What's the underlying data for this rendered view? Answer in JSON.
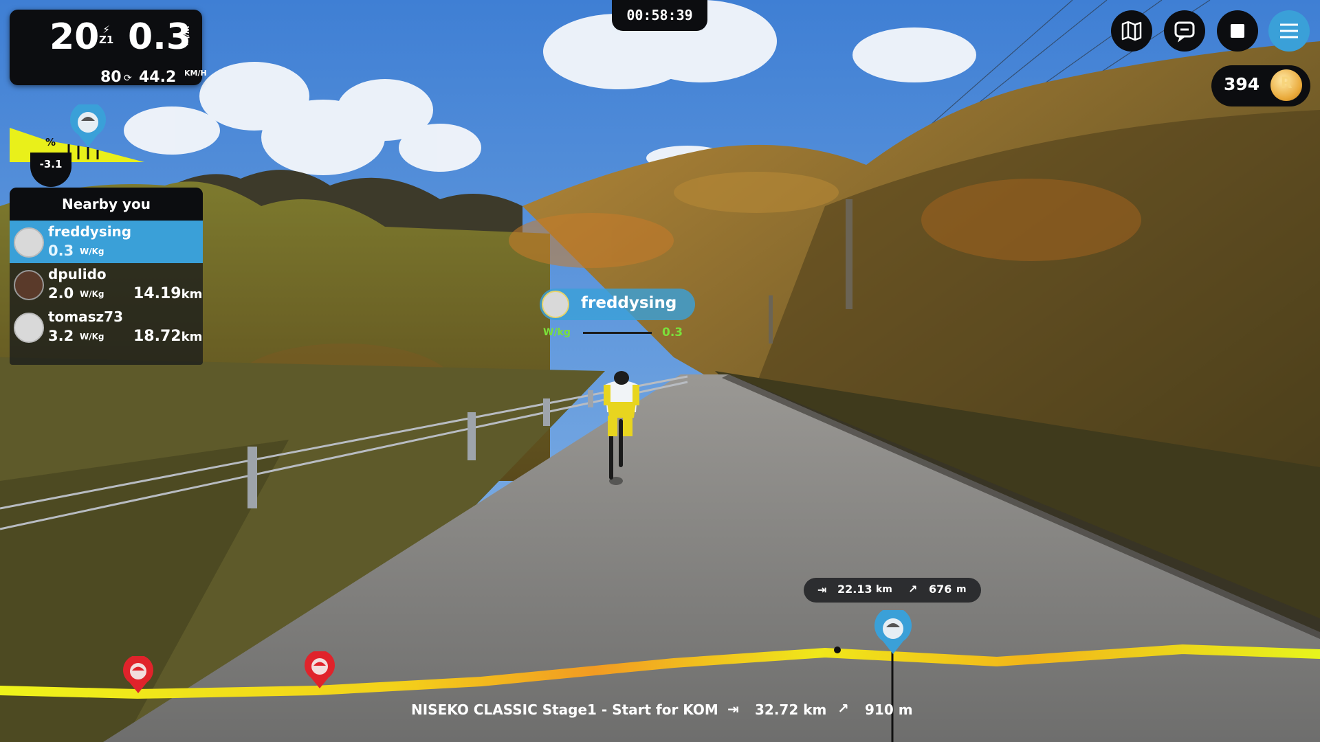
{
  "metrics": {
    "power": "20",
    "zone": "Z1",
    "wkg": "0.3",
    "wkg_unit": "W/kg",
    "cadence": "80",
    "speed": "44.2",
    "speed_unit": "KM/H"
  },
  "gradient": {
    "symbol": "%",
    "value": "-3.1"
  },
  "nearby": {
    "title": "Nearby you",
    "riders": [
      {
        "name": "freddysing",
        "wkg": "0.3",
        "wkg_unit": "W/Kg",
        "distance": "",
        "distance_unit": ""
      },
      {
        "name": "dpulido",
        "wkg": "2.0",
        "wkg_unit": "W/Kg",
        "distance": "14.19",
        "distance_unit": "km"
      },
      {
        "name": "tomasz73",
        "wkg": "3.2",
        "wkg_unit": "W/Kg",
        "distance": "18.72",
        "distance_unit": "km"
      }
    ]
  },
  "timer": "00:58:39",
  "top_buttons": [
    {
      "icon": "map-icon"
    },
    {
      "icon": "chat-icon"
    },
    {
      "icon": "stop-icon"
    },
    {
      "icon": "menu-icon",
      "accent": "#3aa0d8"
    }
  ],
  "coins": {
    "value": "394",
    "coin_letter": "R"
  },
  "rider_tag": {
    "name": "freddysing",
    "wkg_label": "W/kg",
    "wkg": "0.3"
  },
  "next_segment": {
    "distance": "22.13",
    "distance_unit": "km",
    "elevation": "676",
    "elevation_unit": "m"
  },
  "route": {
    "name": "NISEKO CLASSIC Stage1 - Start for KOM",
    "distance": "32.72 km",
    "elevation": "910 m"
  },
  "colors": {
    "accent": "#3aa0d8",
    "panel": "#0c0d10",
    "profile_yellow": "#e9f01a",
    "marker_red": "#e0232b"
  }
}
